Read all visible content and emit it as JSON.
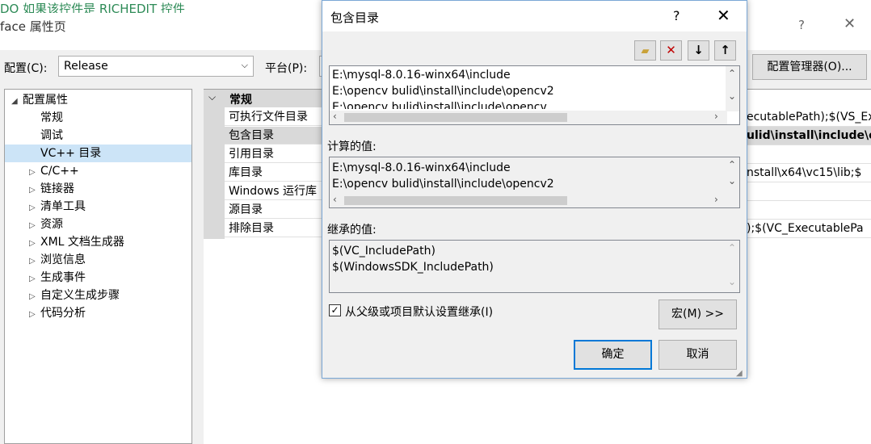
{
  "background_window": {
    "top_text": "DO    如果该控件是 RICHEDIT 控件",
    "title": "face 属性页",
    "help_glyph": "?",
    "close_glyph": "✕",
    "config_label": "配置(C):",
    "config_value": "Release",
    "platform_label": "平台(P):",
    "config_manager_button": "配置管理器(O)...",
    "tree": [
      {
        "label": "配置属性",
        "expander": "◢",
        "indent": 0
      },
      {
        "label": "常规",
        "expander": "",
        "indent": 1
      },
      {
        "label": "调试",
        "expander": "",
        "indent": 1
      },
      {
        "label": "VC++ 目录",
        "expander": "",
        "indent": 1,
        "selected": true
      },
      {
        "label": "C/C++",
        "expander": "▷",
        "indent": 1
      },
      {
        "label": "链接器",
        "expander": "▷",
        "indent": 1
      },
      {
        "label": "清单工具",
        "expander": "▷",
        "indent": 1
      },
      {
        "label": "资源",
        "expander": "▷",
        "indent": 1
      },
      {
        "label": "XML 文档生成器",
        "expander": "▷",
        "indent": 1
      },
      {
        "label": "浏览信息",
        "expander": "▷",
        "indent": 1
      },
      {
        "label": "生成事件",
        "expander": "▷",
        "indent": 1
      },
      {
        "label": "自定义生成步骤",
        "expander": "▷",
        "indent": 1
      },
      {
        "label": "代码分析",
        "expander": "▷",
        "indent": 1
      }
    ],
    "grid_category": "常规",
    "grid_rows": [
      {
        "label": "可执行文件目录",
        "value": "ecutablePath);$(VS_Ex"
      },
      {
        "label": "包含目录",
        "value": "ulid\\install\\include\\o",
        "selected": true
      },
      {
        "label": "引用目录",
        "value": ""
      },
      {
        "label": "库目录",
        "value": "nstall\\x64\\vc15\\lib;$"
      },
      {
        "label": "Windows 运行库",
        "value": ""
      },
      {
        "label": "源目录",
        "value": ""
      },
      {
        "label": "排除目录",
        "value": ");$(VC_ExecutablePa"
      }
    ]
  },
  "dialog": {
    "title": "包含目录",
    "help_glyph": "?",
    "close_glyph": "✕",
    "toolbar": {
      "new_line_icon": "📁",
      "delete_icon": "✕",
      "move_down_icon": "↓",
      "move_up_icon": "↑"
    },
    "edit_lines": [
      "E:\\mysql-8.0.16-winx64\\include",
      "E:\\opencv bulid\\install\\include\\opencv2",
      "E:\\opencv bulid\\install\\include\\opencv"
    ],
    "evaluated_label": "计算的值:",
    "evaluated_lines": [
      "E:\\mysql-8.0.16-winx64\\include",
      "E:\\opencv bulid\\install\\include\\opencv2"
    ],
    "inherited_label": "继承的值:",
    "inherited_lines": [
      "$(VC_IncludePath)",
      "$(WindowsSDK_IncludePath)"
    ],
    "inherit_checkbox_label": "从父级或项目默认设置继承(I)",
    "inherit_checked": true,
    "macros_button": "宏(M) >>",
    "ok_button": "确定",
    "cancel_button": "取消"
  }
}
